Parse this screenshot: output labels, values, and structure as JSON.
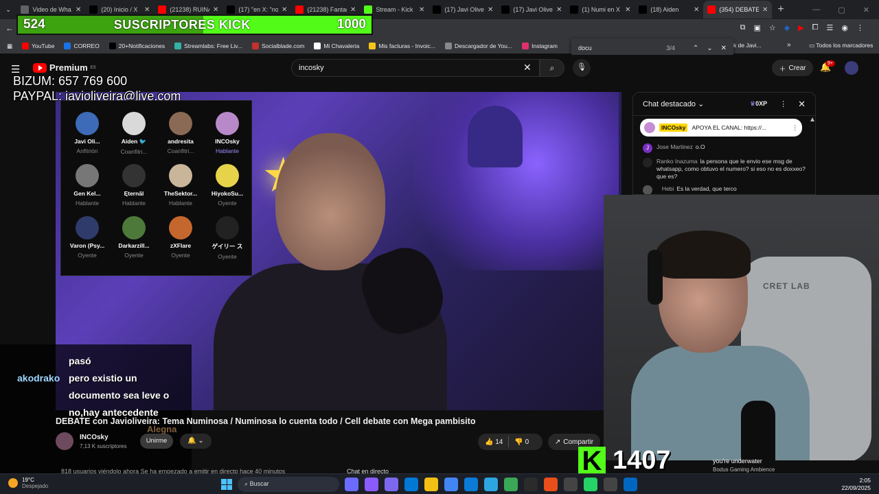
{
  "browser": {
    "tabs": [
      {
        "title": "Video de Wha",
        "color": "#5f6368"
      },
      {
        "title": "(20) Inicio / X",
        "color": "#000000"
      },
      {
        "title": "(21238) RUINA",
        "color": "#ff0000"
      },
      {
        "title": "(17) \"en X: \"no",
        "color": "#000000"
      },
      {
        "title": "(21238) Fantag",
        "color": "#ff0000"
      },
      {
        "title": "Stream - Kick",
        "color": "#53fc18"
      },
      {
        "title": "(17) Javi Olivei",
        "color": "#000000"
      },
      {
        "title": "(17) Javi Olivei",
        "color": "#000000"
      },
      {
        "title": "(1) Numi en X",
        "color": "#000000"
      },
      {
        "title": "(18) Aiden",
        "color": "#000000"
      },
      {
        "title": "(354) DEBATE",
        "color": "#ff0000",
        "active": true
      }
    ],
    "bookmarks": [
      "YouTube",
      "CORREO",
      "20+Notificaciones",
      "Streamlabs: Free Liv...",
      "Socialblade.com",
      "Mi Chavaleria",
      "Mis facturas - Invoic...",
      "Descargador de You...",
      "Instagram"
    ],
    "bookmarks_more": "Todos los marcadores",
    "bookmark_partial": "k de Javi..."
  },
  "find_bar": {
    "query": "docu",
    "count": "3/4"
  },
  "kick_goal": {
    "current": "524",
    "label": "SUSCRIPTORES KICK",
    "goal": "1000",
    "progress": 0.524
  },
  "youtube": {
    "logo_text": "Premium",
    "logo_region": "ES",
    "search_value": "incosky",
    "create_label": "Crear",
    "notif_count": "9+"
  },
  "overlay": {
    "bizum": "BIZUM: 657 769 600",
    "paypal": "PAYPAL: javioliveira@live.com"
  },
  "guests": [
    {
      "name": "Javi Oli...",
      "role": "Anfitrión",
      "color": "#3d6bb8",
      "speaking": false
    },
    {
      "name": "Aiden 🐦",
      "role": "Coanfitri...",
      "color": "#d9d9d9",
      "speaking": false
    },
    {
      "name": "andresita",
      "role": "Coanfitri...",
      "color": "#8a6a55",
      "speaking": false
    },
    {
      "name": "INCOsky",
      "role": "Hablante",
      "color": "#b889c8",
      "speaking": true
    },
    {
      "name": "Gen Kel...",
      "role": "Hablante",
      "color": "#777777",
      "speaking": false
    },
    {
      "name": "Ęternāl",
      "role": "Hablante",
      "color": "#333333",
      "speaking": false
    },
    {
      "name": "TheSektor...",
      "role": "Hablante",
      "color": "#c9b59a",
      "speaking": false
    },
    {
      "name": "HiyokoSu...",
      "role": "Oyente",
      "color": "#e6d34a",
      "speaking": false
    },
    {
      "name": "Varon (Psy...",
      "role": "Oyente",
      "color": "#2e3b6b",
      "speaking": false
    },
    {
      "name": "Darkarzill...",
      "role": "Oyente",
      "color": "#4d7a3a",
      "speaking": false
    },
    {
      "name": "zXFlare",
      "role": "Oyente",
      "color": "#c4672e",
      "speaking": false
    },
    {
      "name": "ゲイリー ス",
      "role": "Oyente",
      "color": "#222222",
      "speaking": false
    }
  ],
  "chat": {
    "title": "Chat destacado",
    "xp": "0XP",
    "pinned": {
      "user": "INCOsky",
      "text": "APOYA EL CANAL: https://..."
    },
    "messages": [
      {
        "user": "Jose Martinez",
        "text": "o.O",
        "color": "#7b2fbf",
        "initial": "J"
      },
      {
        "user": "Ranko Inazuma",
        "text": "la persona que le envio ese msg de whatsapp, como obtuvo el numero? si eso no es doxxeo? que es?",
        "color": "#222222",
        "initial": ""
      },
      {
        "user": "ㅤHebi",
        "text": "Es la verdad, que terco",
        "color": "#555555",
        "initial": ""
      }
    ]
  },
  "caption": {
    "user": "akodrako",
    "lines": [
      "pasó",
      "pero existio un",
      "documento sea leve o",
      "no,hay antecedente"
    ]
  },
  "alegna": "Alegna",
  "video": {
    "title": "DEBATE con Javioliveira: Tema Numinosa / Numinosa lo cuenta todo / Cell debate con Mega pambisito",
    "channel": "INCOsky",
    "subs": "7,13 K suscriptores",
    "join_label": "Unirme",
    "likes": "14",
    "dislikes": "0",
    "share_label": "Compartir",
    "viewers": "818 usuarios viéndolo ahora  Se ha empezado a emitir en directo hace 40 minutos",
    "chat_label": "Chat en directo"
  },
  "webcam": {
    "chair_text": "CRET LAB"
  },
  "kick_counter": {
    "letter": "K",
    "count": "1407"
  },
  "now_playing": {
    "title": "you're underwater",
    "artist": "Bodus Gaming Ambience"
  },
  "taskbar": {
    "temp": "19°C",
    "weather": "Despejado",
    "search_placeholder": "Buscar",
    "time": "2:05",
    "date": "22/09/2025",
    "apps": [
      "#6b6bff",
      "#8a5cff",
      "#7b68ee",
      "#0078d4",
      "#f2c012",
      "#4285f4",
      "#0a7bd6",
      "#2ca5e0",
      "#3aa757",
      "#2b2b2b",
      "#e94e1b",
      "#444444",
      "#25d366",
      "#444444",
      "#0067c0"
    ]
  }
}
